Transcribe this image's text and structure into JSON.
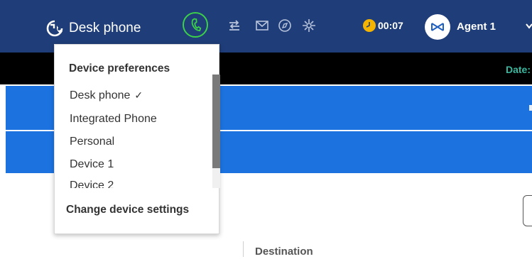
{
  "header": {
    "device_icon": "phone-arrow-icon",
    "device_label": "Desk phone",
    "phone_button_icon": "handset-icon",
    "toolbar_icons": [
      "transfer-icon",
      "email-icon",
      "compass-icon",
      "settings-burst-icon"
    ],
    "timer_icon": "clock-icon",
    "timer": "00:07",
    "agent_avatar_icon": "agent-logo-icon",
    "agent_name": "Agent 1",
    "agent_menu_icon": "chevron-down-icon"
  },
  "status_bar": {
    "date_label": "Date:"
  },
  "content": {
    "column_header": "Destination"
  },
  "device_menu": {
    "title": "Device preferences",
    "items": [
      {
        "label": "Desk phone",
        "selected": true
      },
      {
        "label": "Integrated Phone",
        "selected": false
      },
      {
        "label": "Personal",
        "selected": false
      },
      {
        "label": "Device 1",
        "selected": false
      },
      {
        "label": "Device 2",
        "selected": false
      }
    ],
    "check_mark": "✓",
    "change_settings": "Change device settings"
  },
  "colors": {
    "topbar": "#1f3d78",
    "band": "#1c73e0",
    "accent_green": "#3bd04a",
    "date_teal": "#37b89f",
    "timer_yellow": "#f5b400"
  }
}
